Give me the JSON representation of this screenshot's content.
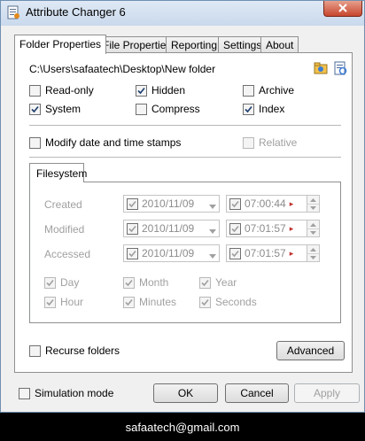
{
  "window": {
    "title": "Attribute Changer 6"
  },
  "tabs": [
    {
      "label": "Folder Properties",
      "active": true
    },
    {
      "label": "File Properties",
      "active": false
    },
    {
      "label": "Reporting",
      "active": false
    },
    {
      "label": "Settings",
      "active": false
    },
    {
      "label": "About",
      "active": false
    }
  ],
  "folder": {
    "path": "C:\\Users\\safaatech\\Desktop\\New folder"
  },
  "attributes": [
    {
      "label": "Read-only",
      "checked": false,
      "enabled": true
    },
    {
      "label": "Hidden",
      "checked": true,
      "enabled": true
    },
    {
      "label": "Archive",
      "checked": false,
      "enabled": true
    },
    {
      "label": "System",
      "checked": true,
      "enabled": true
    },
    {
      "label": "Compress",
      "checked": false,
      "enabled": true
    },
    {
      "label": "Index",
      "checked": true,
      "enabled": true
    }
  ],
  "modify_dates": {
    "label": "Modify date and time stamps",
    "checked": false
  },
  "relative": {
    "label": "Relative",
    "checked": false,
    "enabled": false
  },
  "filesystem": {
    "tab_label": "Filesystem",
    "rows": [
      {
        "label": "Created",
        "date": "2010/11/09",
        "time": "07:00:44"
      },
      {
        "label": "Modified",
        "date": "2010/11/09",
        "time": "07:01:57"
      },
      {
        "label": "Accessed",
        "date": "2010/11/09",
        "time": "07:01:57"
      }
    ],
    "randomize": [
      {
        "label": "Day",
        "checked": true
      },
      {
        "label": "Month",
        "checked": true
      },
      {
        "label": "Year",
        "checked": true
      },
      {
        "label": "Hour",
        "checked": true
      },
      {
        "label": "Minutes",
        "checked": true
      },
      {
        "label": "Seconds",
        "checked": true
      }
    ]
  },
  "recurse": {
    "label": "Recurse folders",
    "checked": false
  },
  "advanced_label": "Advanced",
  "simulation": {
    "label": "Simulation mode",
    "checked": false
  },
  "buttons": {
    "ok": "OK",
    "cancel": "Cancel",
    "apply": "Apply"
  },
  "footer": {
    "email": "safaatech@gmail.com"
  },
  "colors": {
    "titlebar": "#c9d9ec",
    "close": "#c7462d",
    "panel": "#ffffff",
    "background": "#f0f0f0"
  }
}
